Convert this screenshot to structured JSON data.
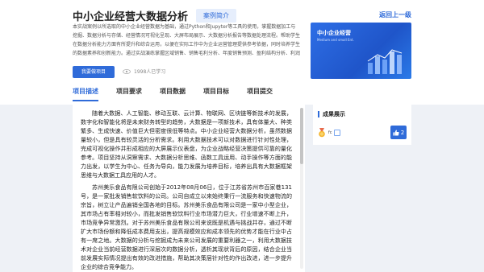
{
  "header": {
    "title": "中小企业经营大数据分析",
    "tag": "案例简介",
    "back_link": "返回上一级"
  },
  "intro": "本实战案例以所选取的中小企业经营数据为基础，通过Python和Jupyter等工具的使用，掌握数据加工与挖掘、数据分析与存储、经营情况可视化呈现、大屏布局展示、大数据分析报告等数据处理流程。帮助学生在数据分析能力方面有所提升和综合运用，以便在实际工作中为企业运营管理提供参考依据，同时培养学生的数据素养和创新能力。通过实战演练掌握区域销售、销售毛利分析、年度销售预测、盈利结构分析、利润贡献分析、预算执行分析、财务指标分析等内容。",
  "learn_button": "我要做项目",
  "learners": "1998人已学习",
  "cover": {
    "title": "中小企业经营",
    "subtitle": "Medium and small Ent."
  },
  "tabs": [
    "项目描述",
    "项目要求",
    "项目数据",
    "项目目标",
    "项目提交"
  ],
  "description": [
    "随着大数据、人工智能、移动互联、云计算、物联网、区块链等新技术的发展，数字化和智能化将是未来财务转型的趋势，大数据是一项新技术，具有体量大、种类繁多、生成快速、价值巨大但密度很低等特点。中小企业经营大数据分析，虽然数据量较小，但是具有较灵活的分析需求。利用大数据技术可以对数据进行针对性处理，完成可视化操作并形成相应的大屏展示仪表盘，为企业战略经营决策提供可靠的量化参考。项目坚持从洞察需求、大数据分析思维、函数工具运用、动手操作等方面的能力出发，以学生为中心、任务为导向，能力发展为培养目标，培养出具有大数据框架思维与大数据工具应用的人才。",
    "苏州美乐食品有限公司创始于2012年08月06日，位于江苏省苏州市百家巷131号，是一家批发销售软饮料的公司。公司自成立以来始终秉行一流服务和快速物流的宗旨，树立让产品遍销全国各地的目标。苏州美乐食品有限公司是一家中小型企业，其市场占有率相对较小，而批发销售软饮料行业市场潜力巨大，行业增速不断上升，市场竞争异常激烈。对于苏州美乐食品有限公司来说既是机遇与挑战并存，通过不断扩大市场份额和降低成本费用支出，提高规模效应和成本领先的优势才能在行业中占有一席之地。大数据的分析与挖掘成为未来公司发展的重要利器之一，利用大数据技术对企业当前经营数据进行深层次的数据分析，透析其现状背后的原因，结合企业当前发展实际情况提出有效的改进措施，帮助其决策层针对性的作出改进，进一步提升企业的综合竞争能力。"
  ],
  "side": {
    "title": "成果展示",
    "user": "fc",
    "likes": "2"
  },
  "colors": {
    "accent": "#2f6bd9",
    "background": "#eef1f6"
  }
}
